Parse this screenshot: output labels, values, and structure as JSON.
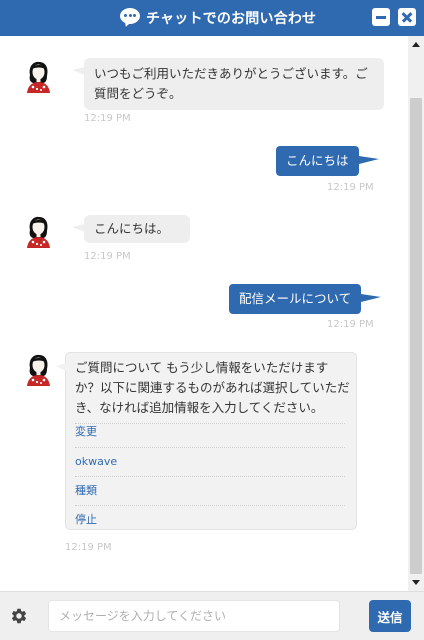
{
  "window": {
    "title": "チャットでのお問い合わせ",
    "accent_color": "#2f6ab0",
    "title_icon": "chat-bubble-icon",
    "minimize_icon": "minimize-icon",
    "close_icon": "close-icon"
  },
  "messages": [
    {
      "from": "operator",
      "text": "いつもご利用いただきありがとうございます。ご質問をどうぞ。",
      "time": "12:19 PM"
    },
    {
      "from": "user",
      "text": "こんにちは",
      "time": "12:19 PM"
    },
    {
      "from": "operator",
      "text": "こんにちは。",
      "time": "12:19 PM"
    },
    {
      "from": "user",
      "text": "配信メールについて",
      "time": "12:19 PM"
    },
    {
      "from": "operator",
      "text": "ご質問について もう少し情報をいただけますか？以下に関連するものがあれば選択していただき、なければ追加情報を入力してください。",
      "options": [
        "変更",
        "okwave",
        "種類",
        "停止"
      ],
      "time": "12:19 PM"
    }
  ],
  "footer": {
    "settings_icon": "gear-icon",
    "input_placeholder": "メッセージを入力してください",
    "input_value": "",
    "send_label": "送信"
  }
}
